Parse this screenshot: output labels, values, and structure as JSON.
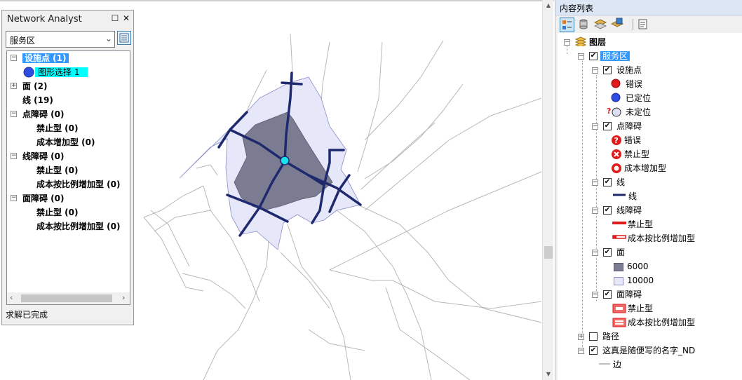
{
  "network_analyst": {
    "title": "Network Analyst",
    "pin_glyph": "☐",
    "close_glyph": "✕",
    "layer_combo": "服务区",
    "status": "求解已完成",
    "tree": {
      "facilities": "设施点 (1)",
      "facility_item": "图形选择 1",
      "polygons": "面 (2)",
      "lines": "线 (19)",
      "point_barriers": "点障碍 (0)",
      "pb_restriction": "禁止型 (0)",
      "pb_added_cost": "成本增加型 (0)",
      "line_barriers": "线障碍 (0)",
      "lb_restriction": "禁止型 (0)",
      "lb_scaled_cost": "成本按比例增加型 (0)",
      "polygon_barriers": "面障碍 (0)",
      "gb_restriction": "禁止型 (0)",
      "gb_scaled_cost": "成本按比例增加型 (0)"
    }
  },
  "toc": {
    "title": "内容列表",
    "root": "图层",
    "service_area": "服务区",
    "facilities": "设施点",
    "facility_error": "错误",
    "facility_located": "已定位",
    "facility_unlocated": "未定位",
    "point_barriers": "点障碍",
    "pb_error": "错误",
    "pb_restriction": "禁止型",
    "pb_added_cost": "成本增加型",
    "lines": "线",
    "lines_sym": "线",
    "line_barriers": "线障碍",
    "lb_restriction": "禁止型",
    "lb_scaled_cost": "成本按比例增加型",
    "polygons": "面",
    "poly_6000": "6000",
    "poly_10000": "10000",
    "polygon_barriers": "面障碍",
    "gb_restriction": "禁止型",
    "gb_scaled_cost": "成本按比例增加型",
    "route": "路径",
    "network_dataset": "这真是随便写的名字_ND",
    "edges": "边"
  },
  "colors": {
    "route_line": "#1f2a6e",
    "inner_poly": "#7b7c92",
    "outer_poly": "#e6e7f8",
    "facility": "#19e3ef",
    "selection": "#3399ff",
    "highlight": "#00ffff",
    "error_red": "#e01b1b",
    "located_blue": "#2d4de3"
  }
}
